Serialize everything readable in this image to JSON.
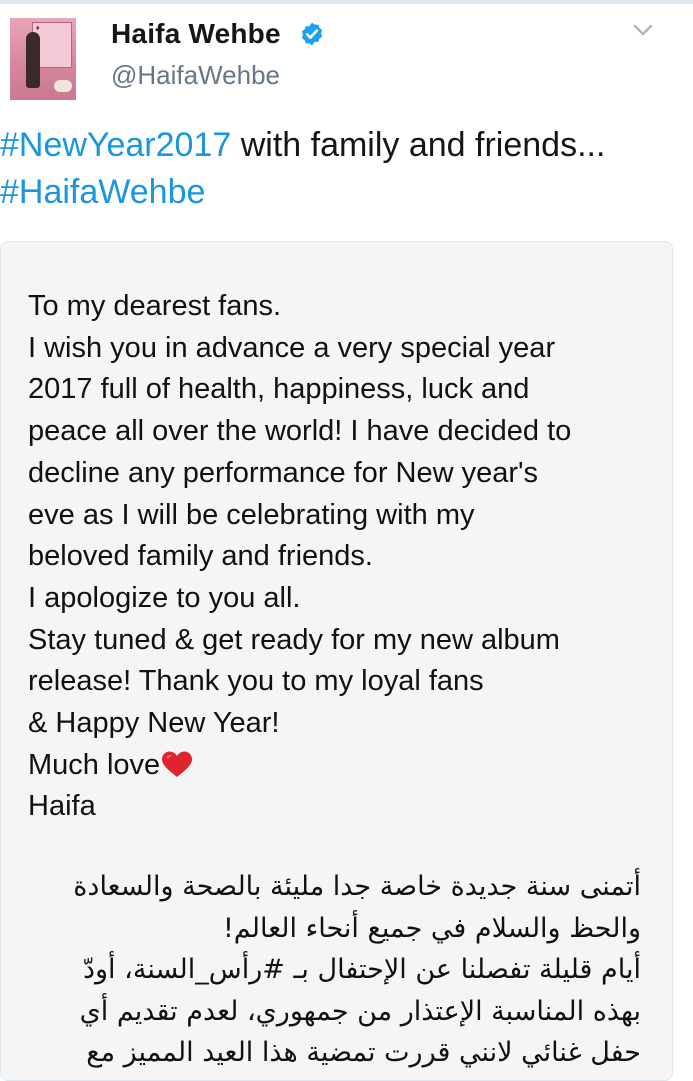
{
  "profile": {
    "display_name": "Haifa Wehbe",
    "handle": "@HaifaWehbe",
    "verified": true,
    "avatar_icon": "profile-photo"
  },
  "tweet": {
    "hashtag1": "#NewYear2017",
    "text1": " with family and friends...",
    "hashtag2": "#HaifaWehbe"
  },
  "letter": {
    "lines_en": [
      "To my dearest fans.",
      "I wish you in advance a very special year",
      "2017 full of health, happiness, luck and",
      "peace all over the world! I have decided to",
      "decline any performance for New year's",
      "eve as I will be celebrating with my",
      "beloved family and friends.",
      "I apologize to you all.",
      "Stay tuned & get ready for my new album",
      "release! Thank you to my loyal fans",
      "& Happy New Year!"
    ],
    "much_love": "Much love",
    "signature": "Haifa",
    "lines_ar": [
      "أتمنى سنة جديدة خاصة جدا مليئة بالصحة والسعادة",
      "والحظ والسلام في جميع أنحاء العالم!",
      "أيام قليلة تفصلنا عن الإحتفال بـ #رأس_السنة، أودّ",
      "بهذه المناسبة الإعتذار من جمهوري، لعدم تقديم أي",
      "حفل غنائي لانني قررت تمضية هذا العيد المميز مع"
    ]
  },
  "colors": {
    "hashtag": "#1b95e0",
    "verified_badge": "#1da1f2",
    "heart": "#e0242f"
  }
}
